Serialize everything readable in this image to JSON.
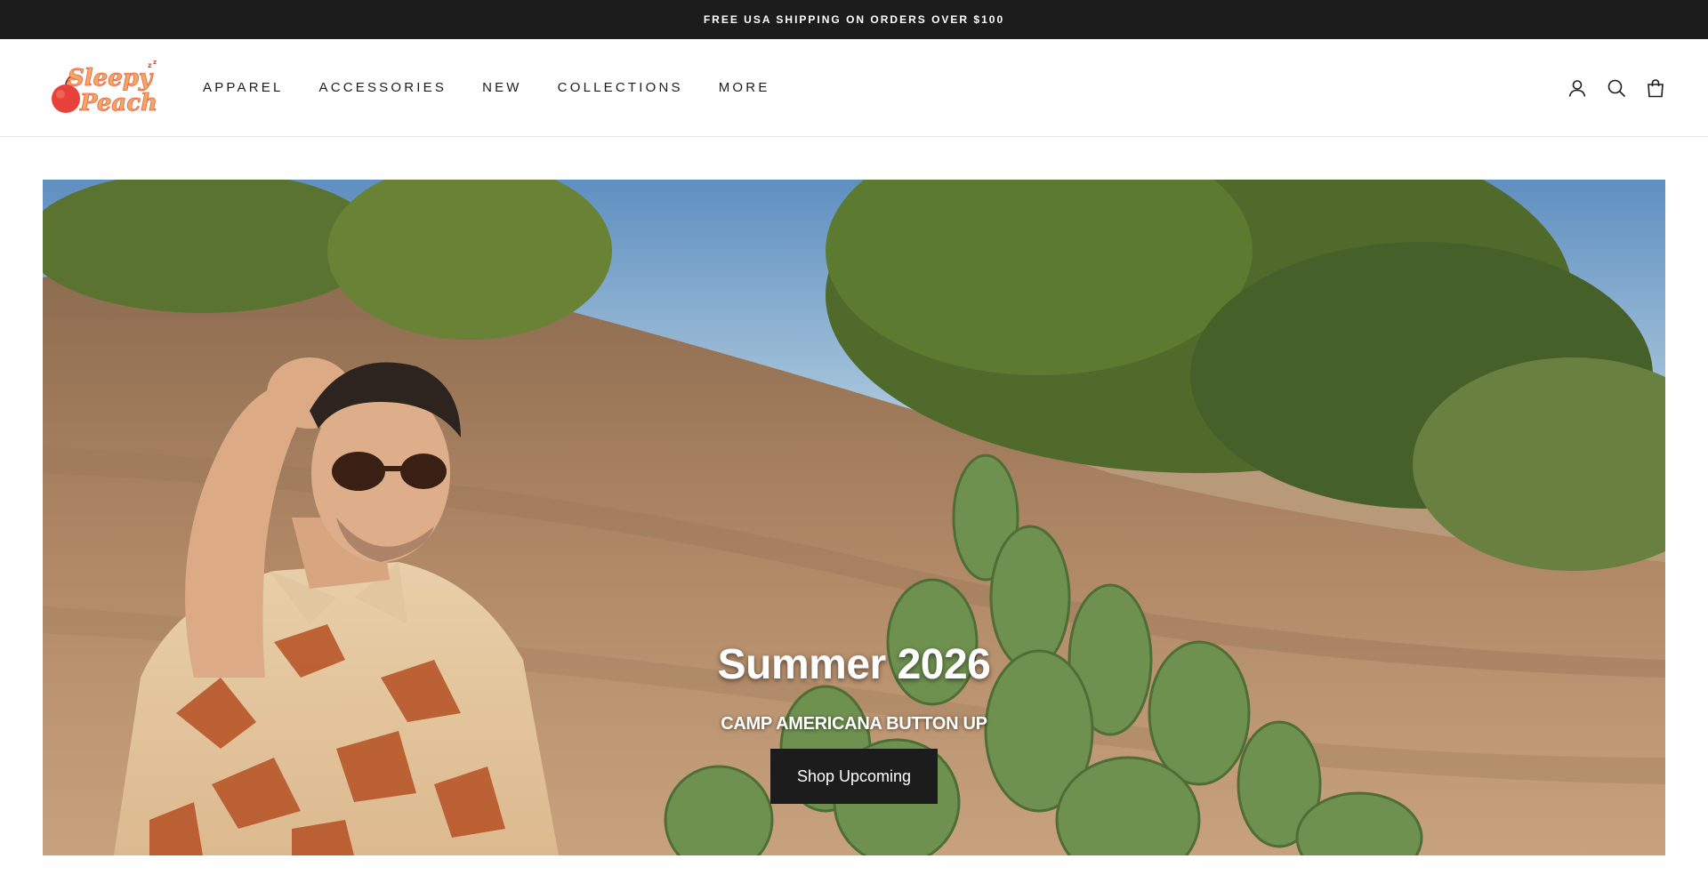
{
  "announcement": {
    "text": "FREE USA SHIPPING ON ORDERS OVER $100"
  },
  "header": {
    "logo_text": "Sleepy Peach",
    "nav": [
      {
        "label": "APPAREL"
      },
      {
        "label": "ACCESSORIES"
      },
      {
        "label": "NEW"
      },
      {
        "label": "COLLECTIONS"
      },
      {
        "label": "MORE"
      }
    ],
    "icons": [
      "account-icon",
      "search-icon",
      "cart-icon"
    ]
  },
  "hero": {
    "title": "Summer 2026",
    "subtitle": "CAMP AMERICANA BUTTON UP",
    "button_label": "Shop Upcoming"
  },
  "colors": {
    "announcement_bg": "#1c1c1d",
    "button_bg": "#1c1c1d",
    "logo_peach": "#f2a766",
    "logo_red": "#e8403a"
  }
}
